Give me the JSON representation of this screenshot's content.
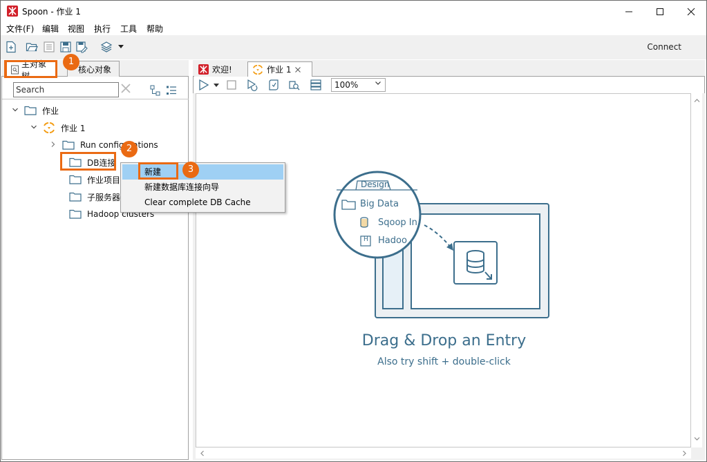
{
  "window": {
    "title": "Spoon - 作业 1",
    "minimize": "—",
    "maximize": "☐",
    "close": "✕"
  },
  "menu": [
    "文件(F)",
    "编辑",
    "视图",
    "执行",
    "工具",
    "帮助"
  ],
  "toolbar": {
    "connect_label": "Connect",
    "icons": [
      "new-file-icon",
      "open-folder-icon",
      "explore-repo-icon",
      "save-icon",
      "save-as-icon",
      "layers-icon",
      "chevron-down-icon"
    ]
  },
  "left_panel": {
    "tabs": [
      "主对象树",
      "核心对象"
    ],
    "search_placeholder": "Search",
    "tree": [
      {
        "label": "作业",
        "level": 0,
        "expanded": true,
        "icon": "folder-icon"
      },
      {
        "label": "作业 1",
        "level": 1,
        "expanded": true,
        "icon": "job-icon"
      },
      {
        "label": "Run configurations",
        "level": 2,
        "expanded": false,
        "icon": "folder-icon"
      },
      {
        "label": "DB连接",
        "level": 2,
        "icon": "folder-icon"
      },
      {
        "label": "作业项目",
        "level": 2,
        "icon": "folder-icon"
      },
      {
        "label": "子服务器",
        "level": 2,
        "icon": "folder-icon"
      },
      {
        "label": "Hadoop clusters",
        "level": 2,
        "icon": "folder-icon"
      }
    ]
  },
  "context_menu": {
    "items": [
      "新建",
      "新建数据库连接向导",
      "Clear complete DB Cache"
    ],
    "highlighted_index": 0
  },
  "callouts": [
    "1",
    "2",
    "3"
  ],
  "editor": {
    "tabs": [
      {
        "label": "欢迎!",
        "icon": "spoon-icon",
        "active": false
      },
      {
        "label": "作业 1",
        "icon": "job-icon",
        "active": true,
        "closable": true
      }
    ],
    "zoom": "100%",
    "canvas_toolbar_icons": [
      "run-icon",
      "run-dropdown-icon",
      "stop-icon",
      "replay-icon",
      "verify-icon",
      "impact-icon",
      "sql-icon"
    ],
    "illustration": {
      "panel_tab": "Design",
      "folder_label": "Big Data",
      "items": [
        "Sqoop In",
        "Hadoo"
      ]
    },
    "drag_title": "Drag & Drop an Entry",
    "drag_subtitle": "Also try shift + double-click"
  },
  "colors": {
    "accent_orange": "#ea6a13",
    "menu_highlight": "#9fd0f4",
    "illustration_blue": "#3c6e8c",
    "brand_red": "#d2202a"
  }
}
